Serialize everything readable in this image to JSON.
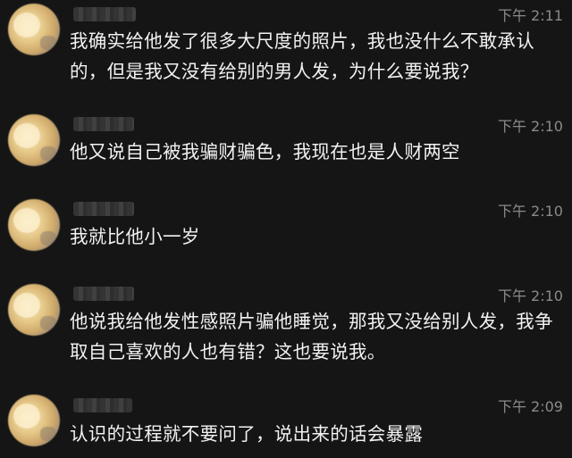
{
  "messages": [
    {
      "time": "下午 2:11",
      "text": "我确实给他发了很多大尺度的照片，我也没什么不敢承认的，但是我又没有给别的男人发，为什么要说我？"
    },
    {
      "time": "下午 2:10",
      "text": "他又说自己被我骗财骗色，我现在也是人财两空"
    },
    {
      "time": "下午 2:10",
      "text": "我就比他小一岁"
    },
    {
      "time": "下午 2:10",
      "text": "他说我给他发性感照片骗他睡觉，那我又没给别人发，我争取自己喜欢的人也有错？这也要说我。"
    },
    {
      "time": "下午 2:09",
      "text": "认识的过程就不要问了，说出来的话会暴露"
    }
  ]
}
